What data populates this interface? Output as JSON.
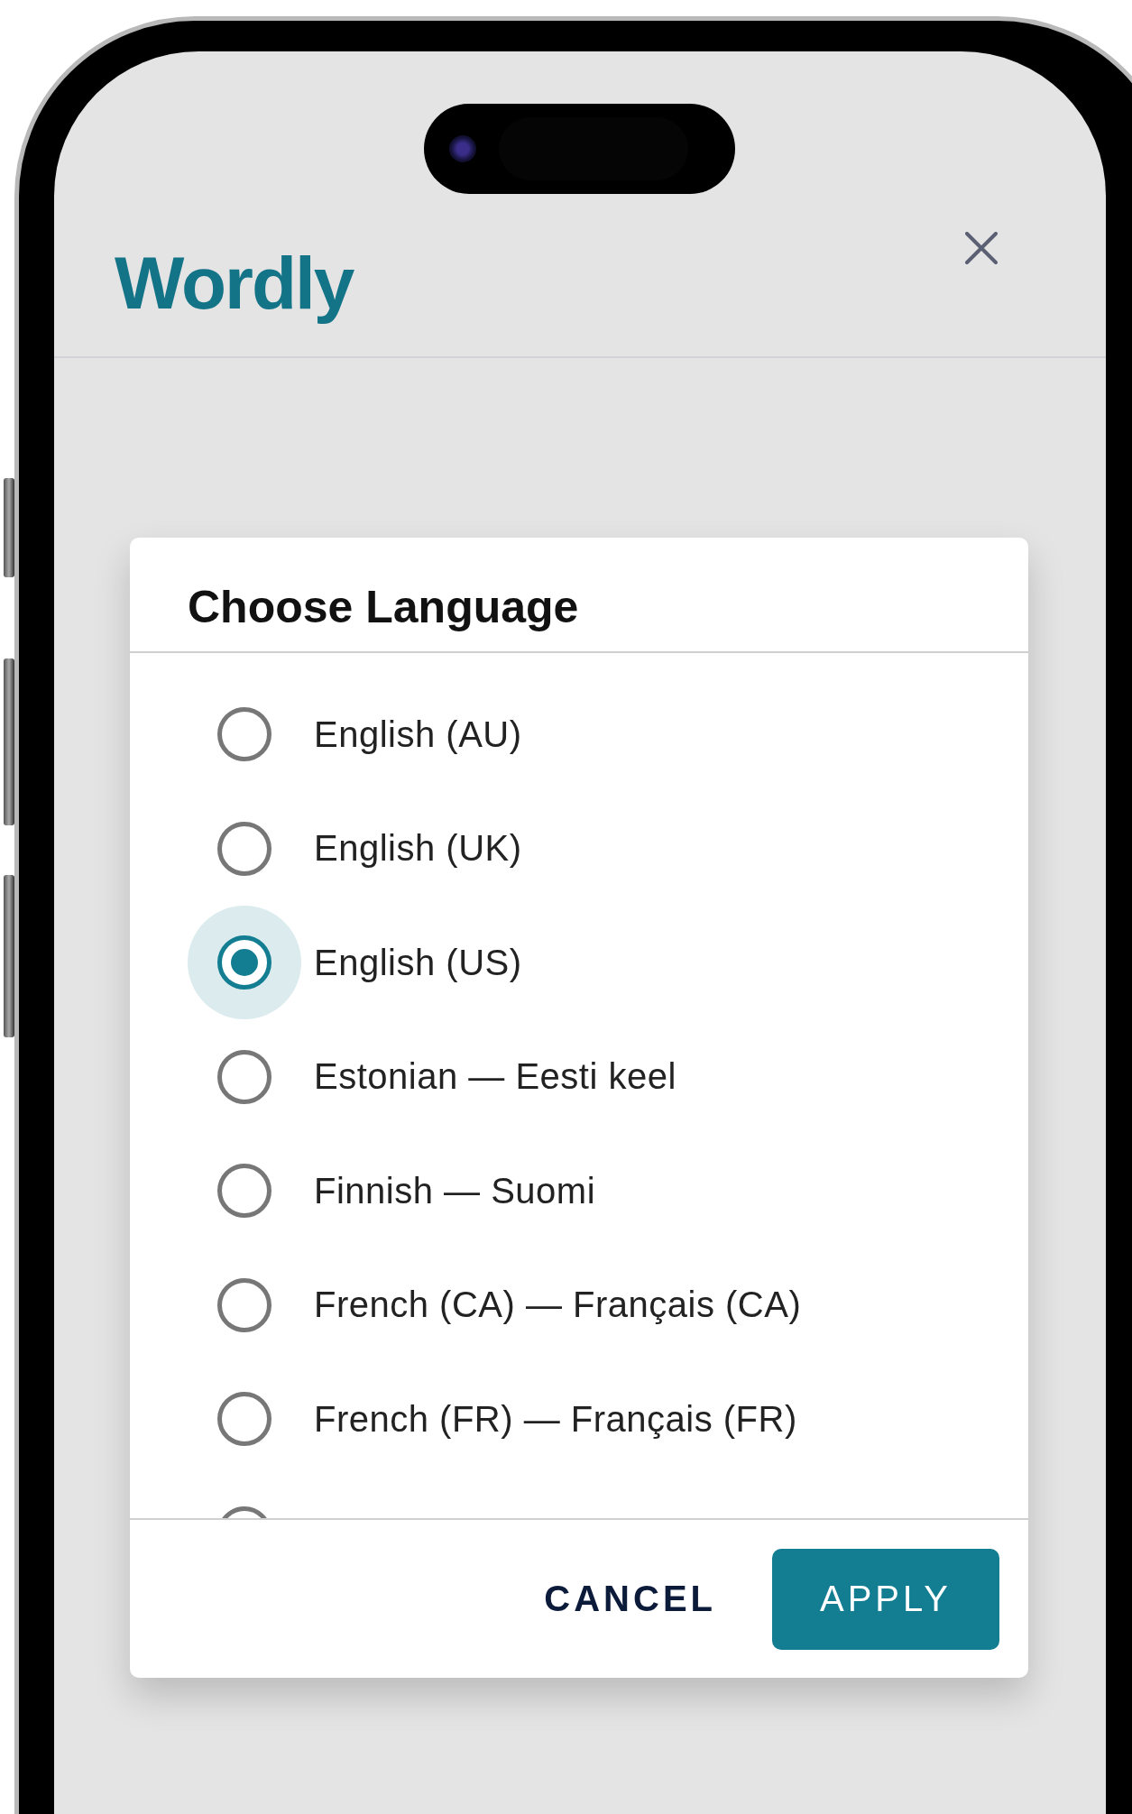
{
  "app": {
    "logo": "Wordly"
  },
  "dialog": {
    "title": "Choose Language",
    "options": [
      {
        "label": "English (AU)",
        "selected": false
      },
      {
        "label": "English (UK)",
        "selected": false
      },
      {
        "label": "English (US)",
        "selected": true
      },
      {
        "label": "Estonian — Eesti keel",
        "selected": false
      },
      {
        "label": "Finnish — Suomi",
        "selected": false
      },
      {
        "label": "French (CA) — Français (CA)",
        "selected": false
      },
      {
        "label": "French (FR) — Français (FR)",
        "selected": false
      },
      {
        "selected": false
      }
    ],
    "buttons": [
      {
        "label": "CANCEL",
        "kind": "text"
      },
      {
        "label": "APPLY",
        "kind": "primary"
      }
    ]
  }
}
